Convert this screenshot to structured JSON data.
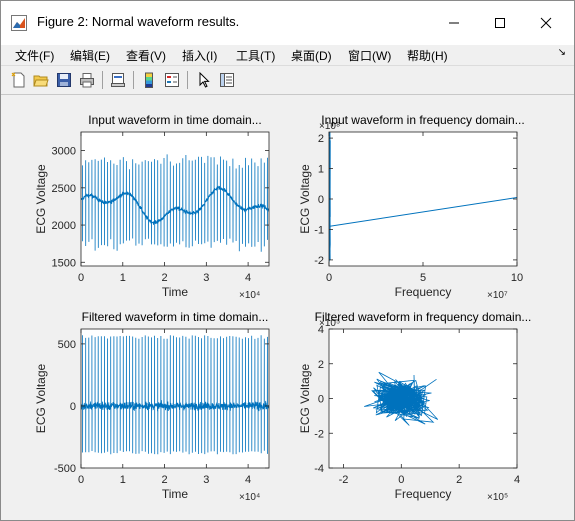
{
  "window": {
    "title": "Figure 2: Normal waveform results.",
    "minimize_glyph": "—",
    "maximize_glyph": "☐",
    "close_glyph": "✕"
  },
  "menu": {
    "items": [
      "文件(F)",
      "编辑(E)",
      "查看(V)",
      "插入(I)",
      "工具(T)",
      "桌面(D)",
      "窗口(W)",
      "帮助(H)"
    ],
    "overflow_glyph": "↘"
  },
  "toolbar": {
    "icons": [
      "new-figure-icon",
      "open-file-icon",
      "save-icon",
      "print-icon",
      "link-plot-icon",
      "colorbar-icon",
      "legend-icon",
      "pointer-icon",
      "property-inspector-icon"
    ]
  },
  "colors": {
    "line": "#0072bd",
    "axes_bg": "#ffffff",
    "figure_bg": "#f0f0f0"
  },
  "chart_data": [
    {
      "type": "line",
      "title": "Input waveform in time domain...",
      "xlabel": "Time",
      "ylabel": "ECG Voltage",
      "xlim": [
        0,
        45000
      ],
      "ylim": [
        1450,
        3250
      ],
      "xticks": [
        0,
        10000,
        20000,
        30000,
        40000
      ],
      "xtick_labels": [
        "0",
        "1",
        "2",
        "3",
        "4"
      ],
      "x_exponent": "×10⁴",
      "yticks": [
        1500,
        2000,
        2500,
        3000
      ],
      "ytick_labels": [
        "1500",
        "2000",
        "2500",
        "3000"
      ],
      "grid": false,
      "signal": {
        "baseline": 2250,
        "wander": 250,
        "spike_peak": 2850,
        "spike_trough": 1750,
        "beats": 60
      }
    },
    {
      "type": "line",
      "title": "Input waveform in frequency domain...",
      "xlabel": "Frequency",
      "ylabel": "ECG Voltage",
      "xlim": [
        0,
        100000000
      ],
      "ylim": [
        -2.2,
        2.2
      ],
      "xticks": [
        0,
        50000000,
        100000000
      ],
      "xtick_labels": [
        "0",
        "5",
        "10"
      ],
      "x_exponent": "×10⁷",
      "yticks": [
        -2,
        -1,
        0,
        1,
        2
      ],
      "ytick_labels": [
        "-2",
        "-1",
        "0",
        "1",
        "2"
      ],
      "y_exponent": "×10⁸",
      "grid": false,
      "segments": [
        {
          "x": [
            0,
            100000000
          ],
          "y": [
            -0.9,
            0.05
          ]
        }
      ],
      "cluster": {
        "x_center": 0,
        "y_min": -2.2,
        "y_max": 2.2
      }
    },
    {
      "type": "line",
      "title": "Filtered waveform in time domain...",
      "xlabel": "Time",
      "ylabel": "ECG Voltage",
      "xlim": [
        0,
        45000
      ],
      "ylim": [
        -500,
        620
      ],
      "xticks": [
        0,
        10000,
        20000,
        30000,
        40000
      ],
      "xtick_labels": [
        "0",
        "1",
        "2",
        "3",
        "4"
      ],
      "x_exponent": "×10⁴",
      "yticks": [
        -500,
        0,
        500
      ],
      "ytick_labels": [
        "-500",
        "0",
        "500"
      ],
      "grid": false,
      "signal": {
        "baseline": 0,
        "spike_peak": 570,
        "spike_trough": -360,
        "beats": 60
      }
    },
    {
      "type": "line",
      "title": "Filtered waveform in frequency domain...",
      "xlabel": "Frequency",
      "ylabel": "ECG Voltage",
      "xlim": [
        -250000,
        400000
      ],
      "ylim": [
        -400000,
        400000
      ],
      "xticks": [
        -200000,
        0,
        200000,
        400000
      ],
      "xtick_labels": [
        "-2",
        "0",
        "2",
        "4"
      ],
      "x_exponent": "×10⁵",
      "yticks": [
        -400000,
        -200000,
        0,
        200000,
        400000
      ],
      "ytick_labels": [
        "-4",
        "-2",
        "0",
        "2",
        "4"
      ],
      "y_exponent": "×10⁵",
      "grid": false,
      "cloud": {
        "x_center": 0,
        "y_center": 0,
        "x_spread": 150000,
        "y_spread": 150000,
        "points": 420
      }
    }
  ]
}
